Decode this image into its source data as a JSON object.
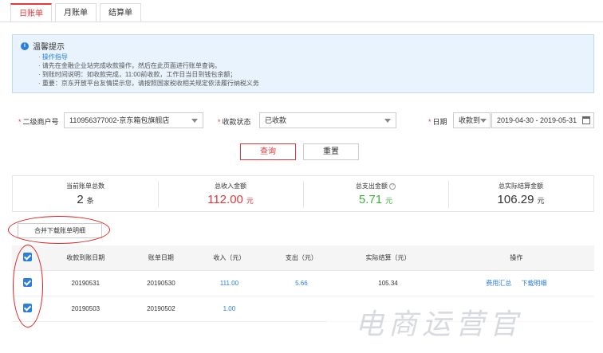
{
  "tabs": [
    "日账单",
    "月账单",
    "结算单"
  ],
  "notice": {
    "title": "温馨提示",
    "items": [
      "操作指导",
      "请先在金融企业站完成收款操作，然后在此页面进行账单查询。",
      "到账时间说明：如收款完成，11:00前收款，工作日当日到钱包余额；",
      "重要：京东开放平台友情提示您，请按照国家税收相关规定依法履行纳税义务"
    ]
  },
  "filters": {
    "merchant_label": "二级商户号",
    "merchant_value": "110956377002-京东箱包旗舰店",
    "status_label": "收款状态",
    "status_value": "已收款",
    "date_label": "日期",
    "date_type": "收款到",
    "date_range": "2019-04-30 - 2019-05-31"
  },
  "buttons": {
    "query": "查询",
    "reset": "重置",
    "merge_download": "合并下载账单明细"
  },
  "summary": [
    {
      "label": "当前账单总数",
      "value": "2",
      "unit": "条"
    },
    {
      "label": "总收入金额",
      "value": "112.00",
      "unit": "元"
    },
    {
      "label": "总支出金额",
      "value": "5.71",
      "unit": "元"
    },
    {
      "label": "总实际结算金额",
      "value": "106.29",
      "unit": "元"
    }
  ],
  "table": {
    "headers": [
      "收款到账日期",
      "账单日期",
      "收入（元）",
      "支出（元）",
      "实际结算（元）",
      "操作"
    ],
    "rows": [
      {
        "pay_date": "20190531",
        "bill_date": "20190530",
        "income": "111.00",
        "expense": "5.66",
        "settle": "105.34",
        "op1": "费用汇总",
        "op2": "下载明细"
      },
      {
        "pay_date": "20190503",
        "bill_date": "20190502",
        "income": "1.00",
        "expense": "",
        "settle": "",
        "op1": "",
        "op2": ""
      }
    ]
  },
  "watermark": "电商运营官",
  "colors": {
    "accent": "#e4393c",
    "link": "#2b7fd9",
    "green": "#3fb040"
  }
}
